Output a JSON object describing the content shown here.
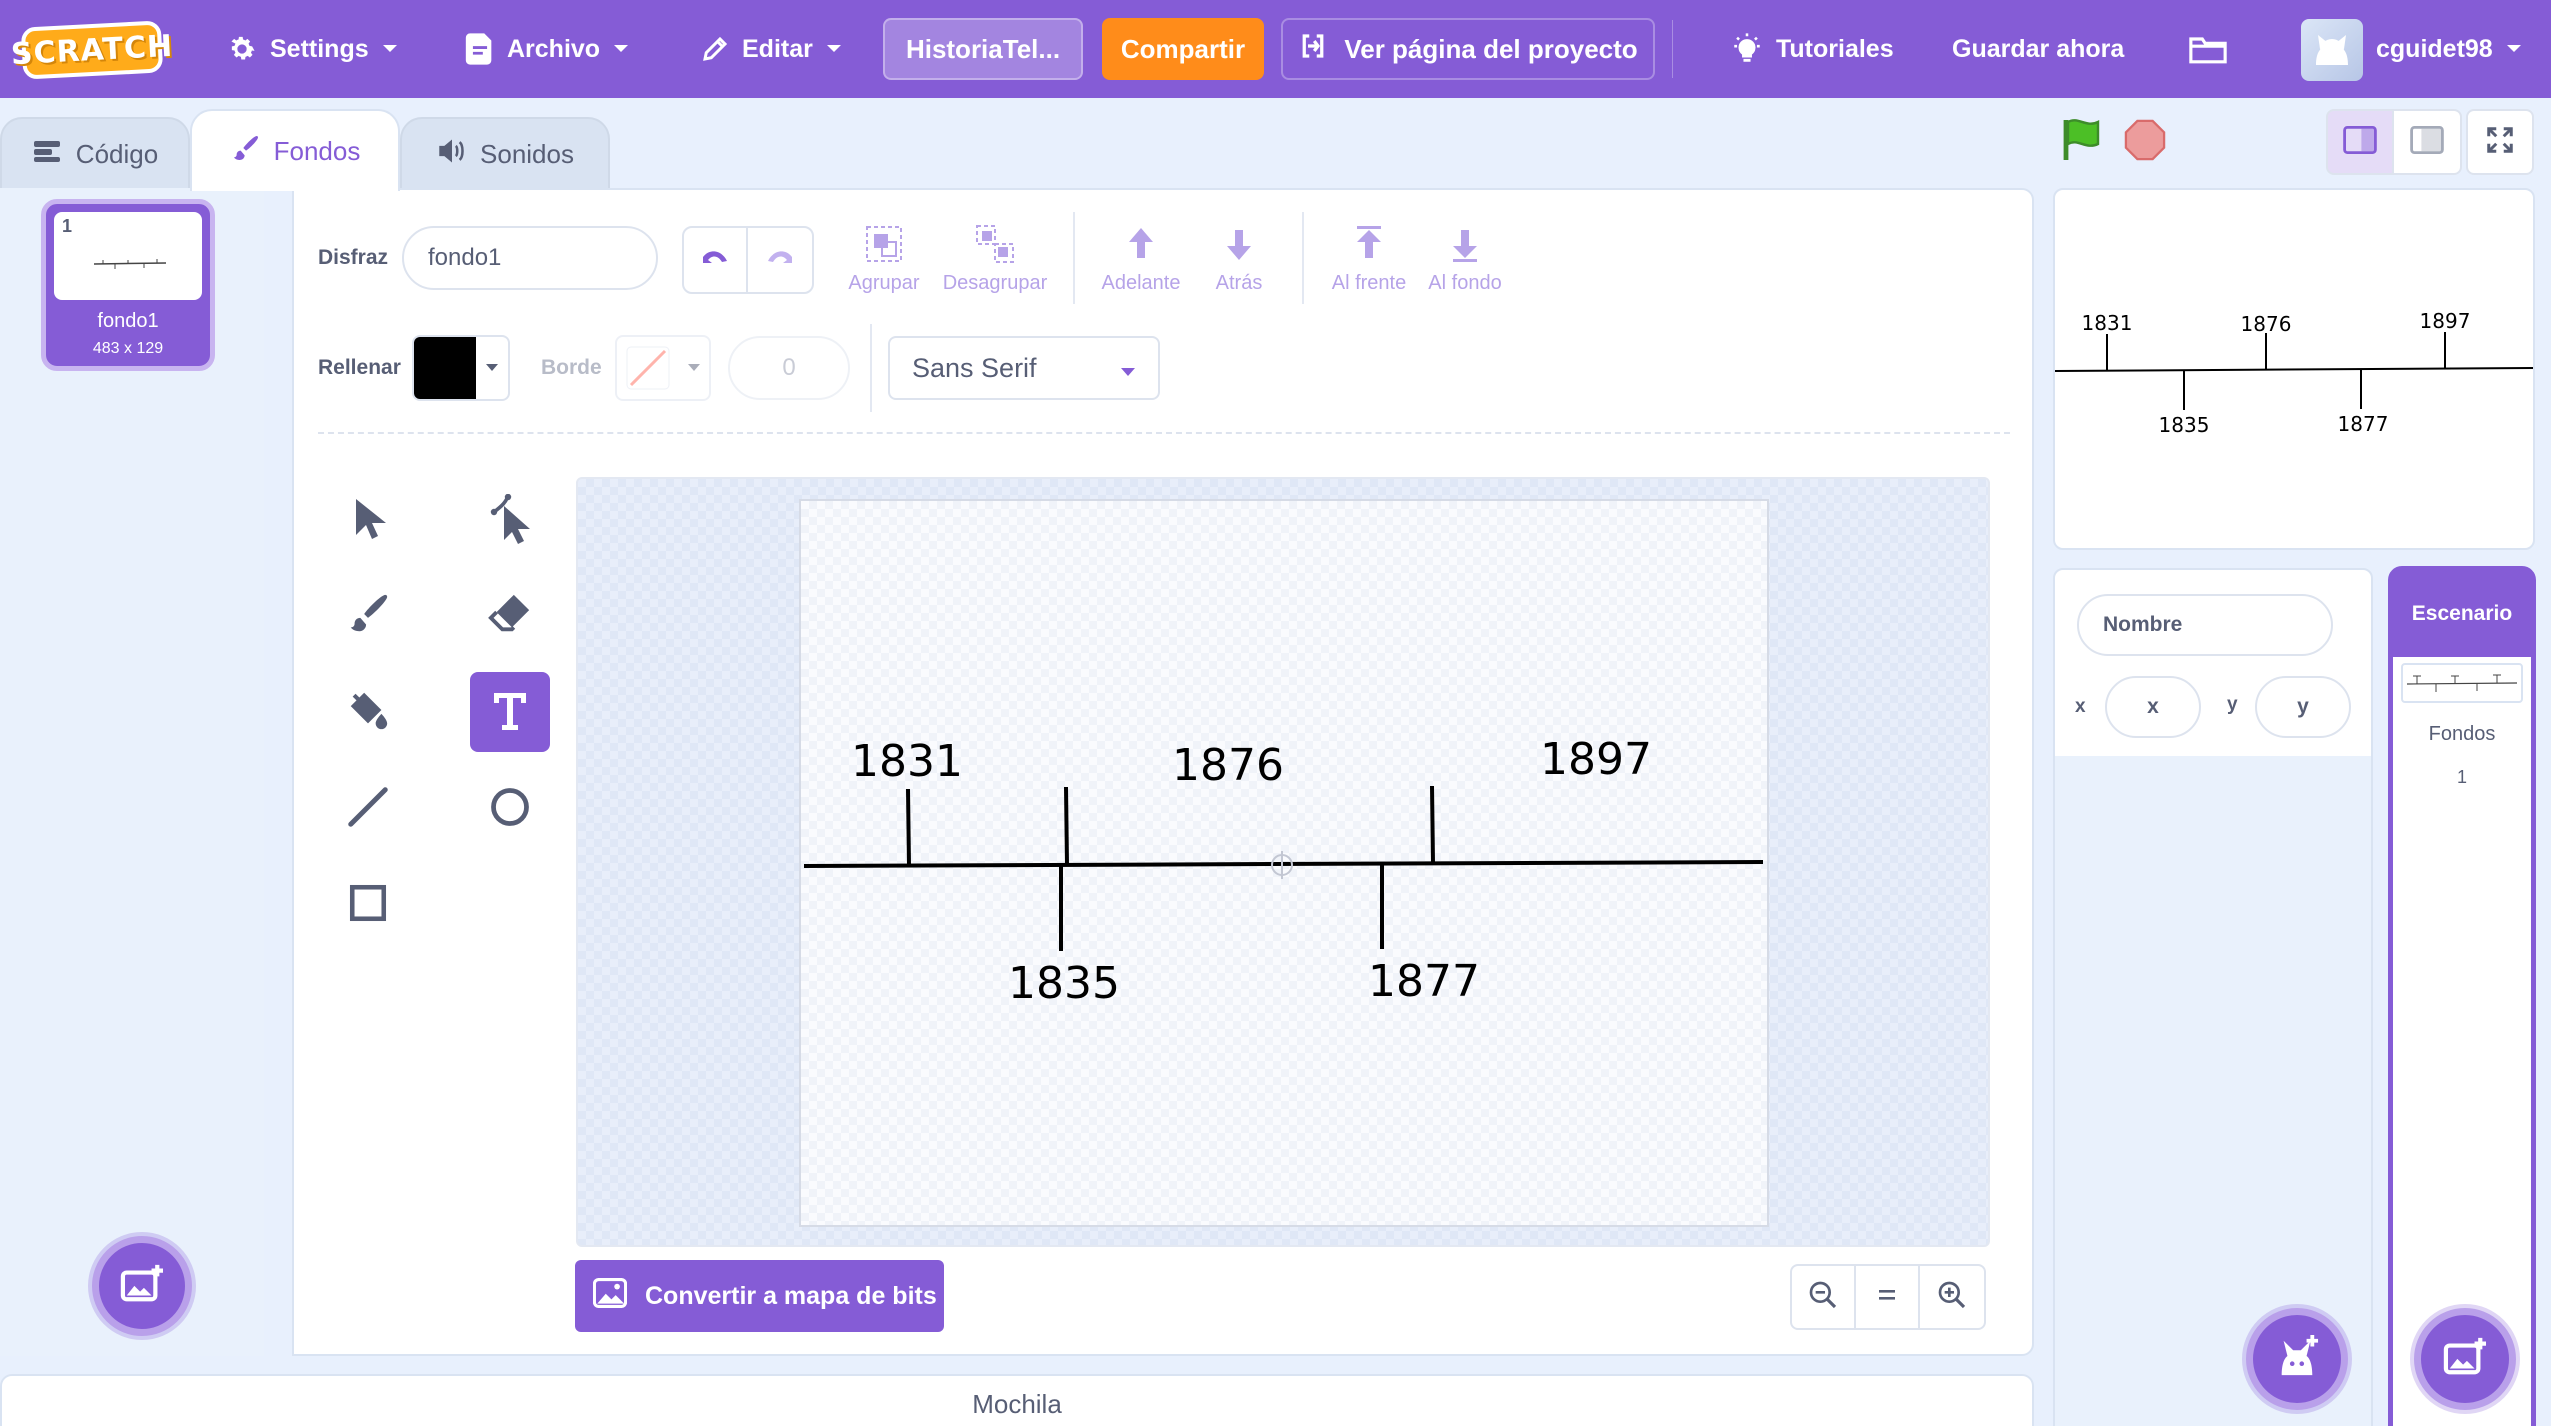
{
  "menubar": {
    "logo": "SCRATCH",
    "settings_label": "Settings",
    "file_label": "Archivo",
    "edit_label": "Editar",
    "project_title": "HistoriaTel...",
    "share_label": "Compartir",
    "see_project_label": "Ver página del proyecto",
    "tutorials_label": "Tutoriales",
    "save_now_label": "Guardar ahora",
    "username": "cguidet98",
    "accent_color": "#855cd6",
    "share_color": "#ff8c1a"
  },
  "tabs": [
    {
      "label": "Código",
      "icon": "code-icon"
    },
    {
      "label": "Fondos",
      "icon": "paintbrush-icon",
      "active": true
    },
    {
      "label": "Sonidos",
      "icon": "speaker-icon"
    }
  ],
  "costumes": [
    {
      "number": "1",
      "name": "fondo1",
      "size": "483 x 129"
    }
  ],
  "paint_editor": {
    "costume_label": "Disfraz",
    "costume_name": "fondo1",
    "group_label": "Agrupar",
    "ungroup_label": "Desagrupar",
    "forward_label": "Adelante",
    "backward_label": "Atrás",
    "front_label": "Al frente",
    "back_label": "Al fondo",
    "fill_label": "Rellenar",
    "fill_color": "#000000",
    "outline_label": "Borde",
    "outline_width": "0",
    "font": "Sans Serif",
    "convert_label": "Convertir a mapa de bits",
    "active_tool": "text-tool"
  },
  "timeline": {
    "above": [
      "1831",
      "1876",
      "1897"
    ],
    "below": [
      "1835",
      "1877"
    ]
  },
  "backpack_label": "Mochila",
  "sprite_info": {
    "name_placeholder": "Nombre",
    "x_label": "x",
    "x_placeholder": "x",
    "y_label": "y",
    "y_placeholder": "y"
  },
  "stage_panel": {
    "title": "Escenario",
    "backdrops_label": "Fondos",
    "backdrops_count": "1"
  }
}
